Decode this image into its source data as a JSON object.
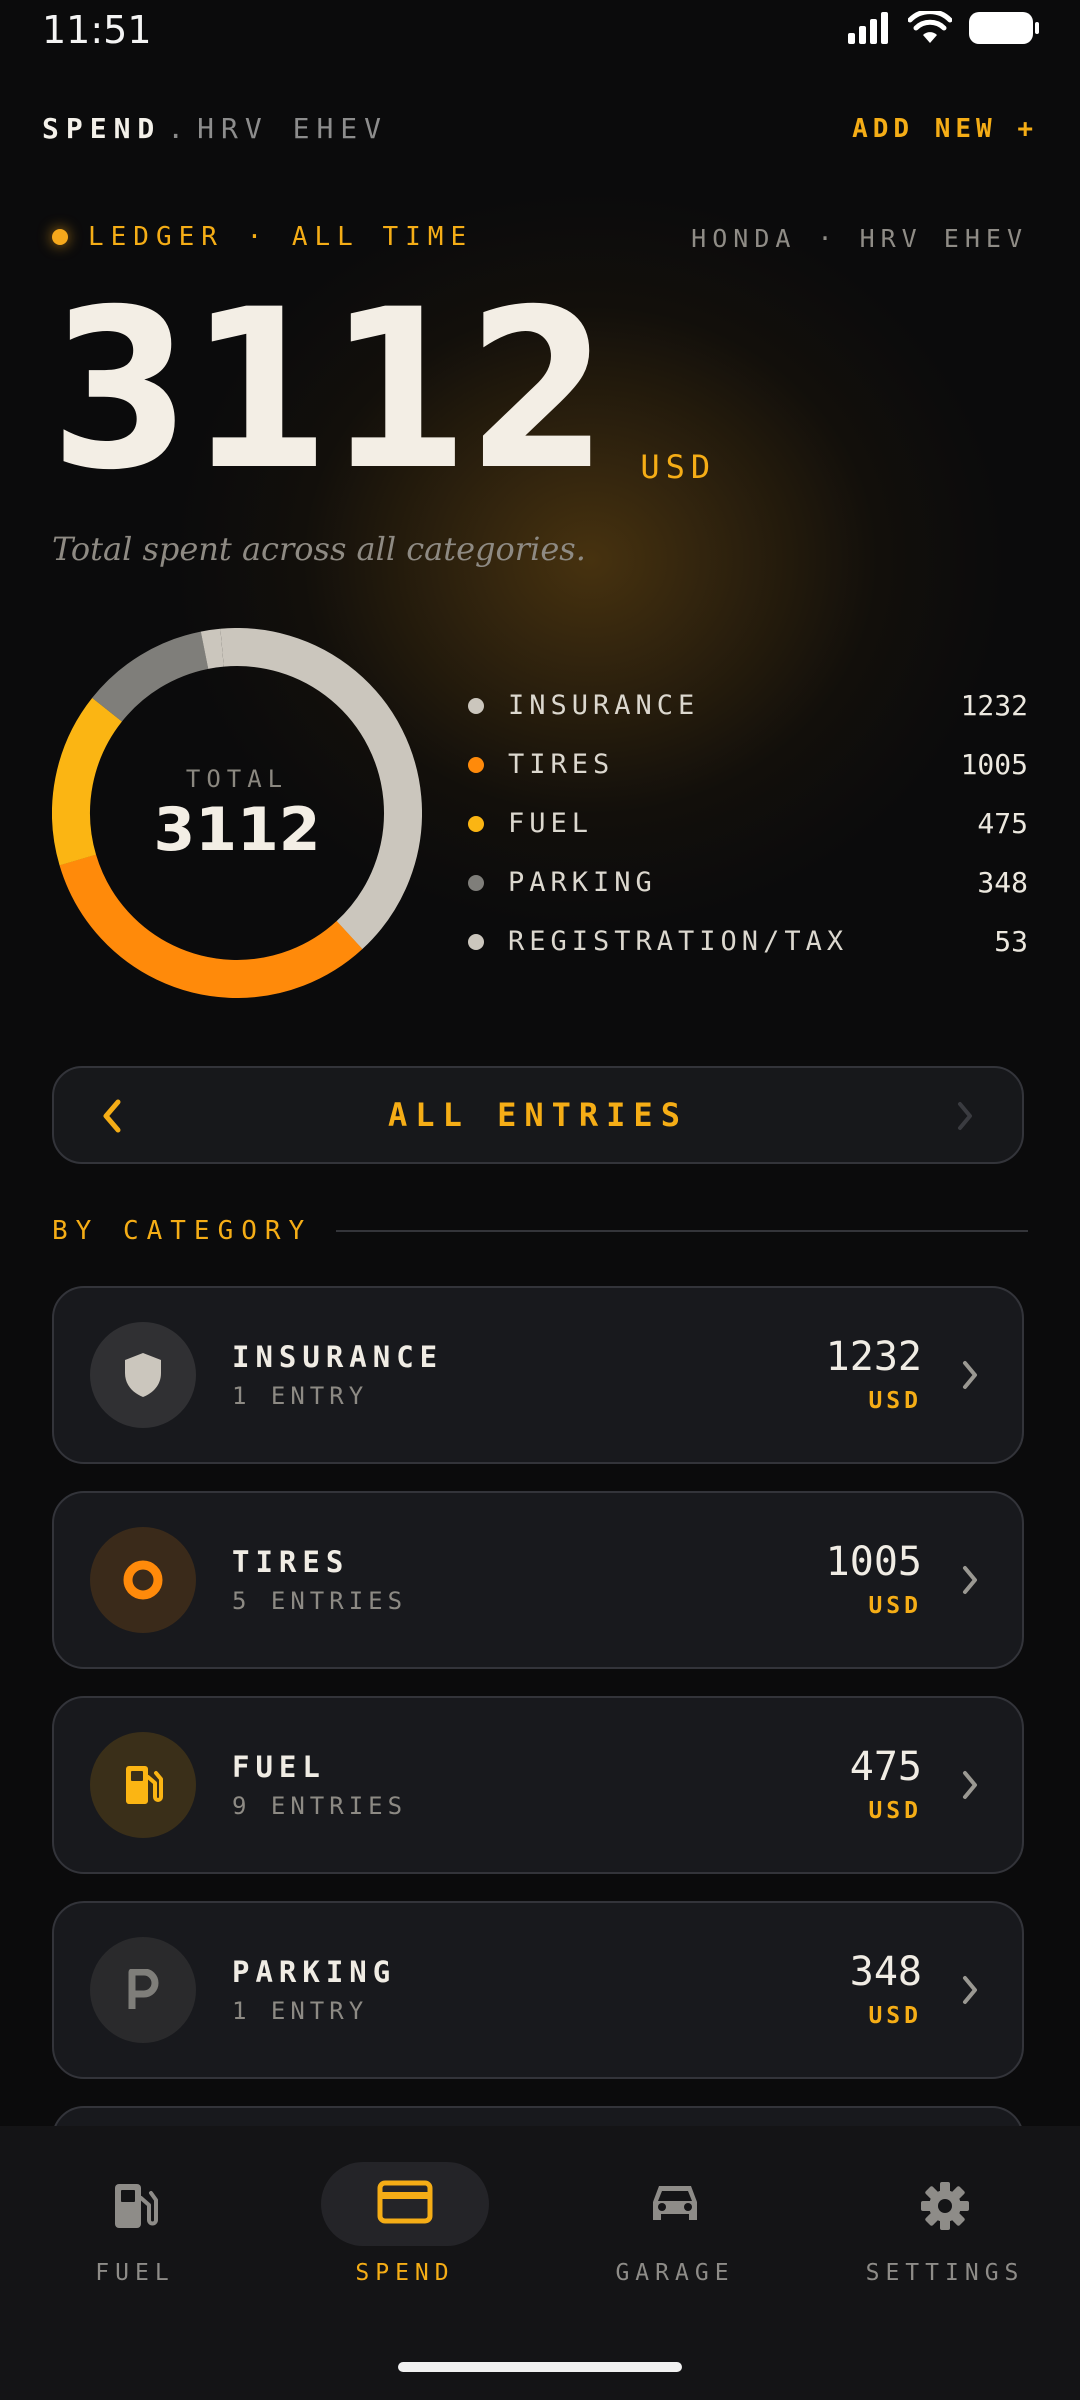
{
  "status_bar": {
    "time": "11:51"
  },
  "header": {
    "title_primary": "SPEND",
    "title_sep": ".",
    "title_secondary": "HRV EHEV",
    "add_new": "ADD NEW +"
  },
  "ledger": {
    "label": "LEDGER · ALL TIME",
    "vehicle": "HONDA · HRV EHEV"
  },
  "total": {
    "value": "3112",
    "currency": "USD",
    "subtitle": "Total spent across all categories."
  },
  "donut": {
    "label": "TOTAL",
    "value": "3112"
  },
  "chart_data": {
    "type": "pie",
    "categories": [
      "INSURANCE",
      "TIRES",
      "FUEL",
      "PARKING",
      "REGISTRATION/TAX"
    ],
    "values": [
      1232,
      1005,
      475,
      348,
      53
    ],
    "colors": [
      "#cbc6bd",
      "#ff8a0a",
      "#fbb513",
      "#7f7e7a",
      "#cbc6bd"
    ]
  },
  "legend": [
    {
      "label": "INSURANCE",
      "value": "1232",
      "color": "#cbc6bd"
    },
    {
      "label": "TIRES",
      "value": "1005",
      "color": "#ff8a0a"
    },
    {
      "label": "FUEL",
      "value": "475",
      "color": "#fbb513"
    },
    {
      "label": "PARKING",
      "value": "348",
      "color": "#7f7e7a"
    },
    {
      "label": "REGISTRATION/TAX",
      "value": "53",
      "color": "#cbc6bd"
    }
  ],
  "entries_nav": {
    "label": "ALL ENTRIES"
  },
  "by_category": {
    "title": "BY CATEGORY",
    "cards": [
      {
        "name": "INSURANCE",
        "count": "1 ENTRY",
        "amount": "1232",
        "currency": "USD",
        "icon": "shield-icon"
      },
      {
        "name": "TIRES",
        "count": "5 ENTRIES",
        "amount": "1005",
        "currency": "USD",
        "icon": "tire-icon"
      },
      {
        "name": "FUEL",
        "count": "9 ENTRIES",
        "amount": "475",
        "currency": "USD",
        "icon": "fuel-pump-icon"
      },
      {
        "name": "PARKING",
        "count": "1 ENTRY",
        "amount": "348",
        "currency": "USD",
        "icon": "parking-icon"
      }
    ]
  },
  "bottom_nav": {
    "items": [
      {
        "label": "FUEL",
        "icon": "fuel-pump-icon",
        "active": false
      },
      {
        "label": "SPEND",
        "icon": "credit-card-icon",
        "active": true
      },
      {
        "label": "GARAGE",
        "icon": "car-icon",
        "active": false
      },
      {
        "label": "SETTINGS",
        "icon": "gear-icon",
        "active": false
      }
    ]
  },
  "colors": {
    "accent": "#f5ad16",
    "background": "#0b0b0c",
    "card": "#18191d"
  }
}
